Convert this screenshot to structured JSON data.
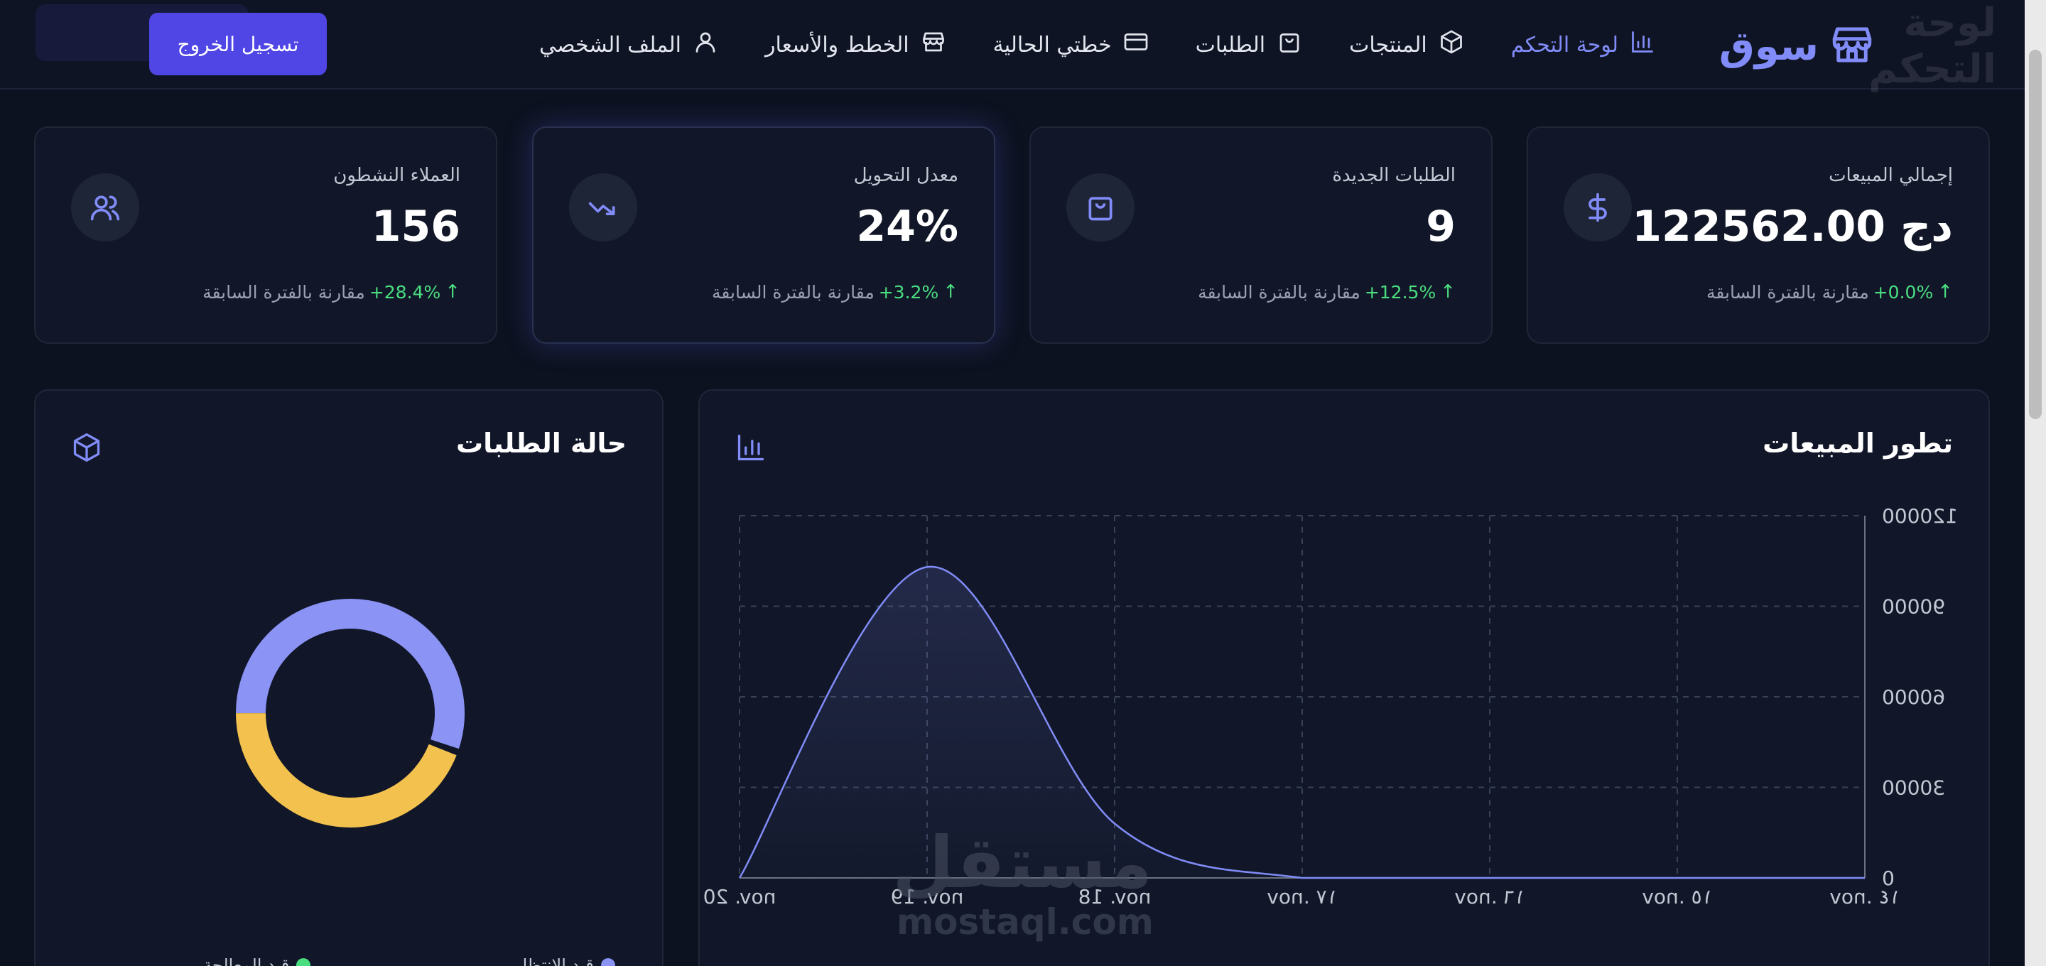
{
  "ghost": {
    "right": "لوحة التحكم",
    "left": ""
  },
  "brand": {
    "name": "سوق"
  },
  "nav": {
    "items": [
      {
        "label": "لوحة التحكم",
        "icon": "bar-chart-icon",
        "active": true
      },
      {
        "label": "المنتجات",
        "icon": "package-icon"
      },
      {
        "label": "الطلبات",
        "icon": "shopping-bag-icon"
      },
      {
        "label": "خطتي الحالية",
        "icon": "credit-card-icon"
      },
      {
        "label": "الخطط والأسعار",
        "icon": "store-icon"
      },
      {
        "label": "الملف الشخصي",
        "icon": "user-icon"
      }
    ],
    "logout": "تسجيل الخروج"
  },
  "stats": [
    {
      "label": "إجمالي المبيعات",
      "value": "122562.00 دج",
      "change": "+0.0%",
      "note": "مقارنة بالفترة السابقة",
      "icon": "dollar-icon"
    },
    {
      "label": "الطلبات الجديدة",
      "value": "9",
      "change": "+12.5%",
      "note": "مقارنة بالفترة السابقة",
      "icon": "shopping-bag-icon"
    },
    {
      "label": "معدل التحويل",
      "value": "24%",
      "change": "+3.2%",
      "note": "مقارنة بالفترة السابقة",
      "icon": "trending-icon"
    },
    {
      "label": "العملاء النشطون",
      "value": "156",
      "change": "+28.4%",
      "note": "مقارنة بالفترة السابقة",
      "icon": "users-icon"
    }
  ],
  "sales_panel": {
    "title": "تطور المبيعات"
  },
  "orders_panel": {
    "title": "حالة الطلبات"
  },
  "chart_data": [
    {
      "type": "area",
      "title": "تطور المبيعات",
      "x": [
        "nov. ١٤",
        "nov. ١٥",
        "nov. ١٦",
        "nov. ١٧",
        "nov. 18",
        "nov. 19",
        "nov. 20"
      ],
      "y": [
        0,
        0,
        0,
        0,
        18000,
        103000,
        0
      ],
      "yticks": [
        "0",
        "30000",
        "60000",
        "90000",
        "120000"
      ],
      "ylim": [
        0,
        120000
      ],
      "grid": true,
      "color": "#818cf8"
    },
    {
      "type": "pie",
      "title": "حالة الطلبات",
      "categories": [
        "قيد الانتظار",
        "قيد المعالجة"
      ],
      "values": [
        56,
        44
      ],
      "colors": [
        "#8b93f5",
        "#f2c14e"
      ],
      "legend": "bottom"
    }
  ],
  "watermark": {
    "ar": "مستقل",
    "en": "mostaql.com"
  },
  "colors": {
    "accent": "#4f46e5",
    "positive": "#4ade80",
    "background": "#0d1220",
    "card": "#111728"
  }
}
